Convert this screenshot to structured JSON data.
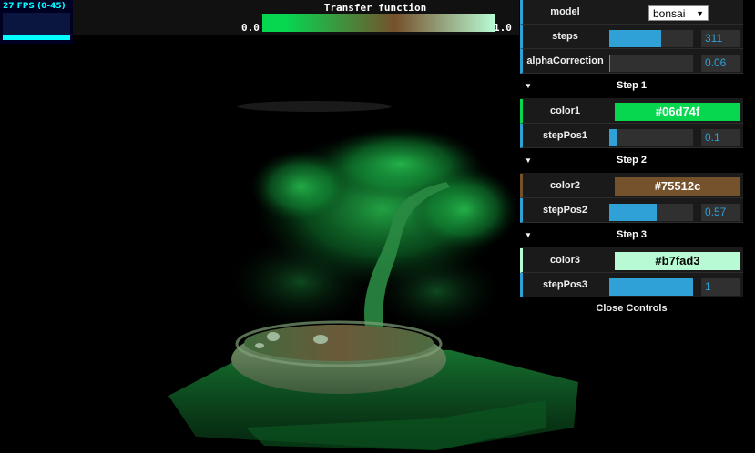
{
  "stats": {
    "fps_label": "27 FPS (0-45)",
    "fps_value": 27,
    "fps_max": 45
  },
  "transfer_function": {
    "title": "Transfer function",
    "min_label": "0.0",
    "max_label": "1.0",
    "colors": [
      "#06d74f",
      "#75512c",
      "#b7fad3"
    ],
    "stops": [
      0.1,
      0.57,
      1.0
    ]
  },
  "gui": {
    "model": {
      "label": "model",
      "value": "bonsai"
    },
    "steps": {
      "label": "steps",
      "value": "311",
      "fraction": 0.62
    },
    "alpha": {
      "label": "alphaCorrection",
      "value": "0.06",
      "fraction": 0.01
    },
    "step1": {
      "title": "Step 1",
      "color_label": "color1",
      "color": "#06d74f",
      "pos_label": "stepPos1",
      "pos_value": "0.1",
      "pos_fraction": 0.1
    },
    "step2": {
      "title": "Step 2",
      "color_label": "color2",
      "color": "#75512c",
      "pos_label": "stepPos2",
      "pos_value": "0.57",
      "pos_fraction": 0.57
    },
    "step3": {
      "title": "Step 3",
      "color_label": "color3",
      "color": "#b7fad3",
      "pos_label": "stepPos3",
      "pos_value": "1",
      "pos_fraction": 1.0
    },
    "close_label": "Close Controls"
  },
  "colors": {
    "accent": "#2fa1d6",
    "panel_bg": "#1a1a1a",
    "stats_text": "#00ffff"
  }
}
